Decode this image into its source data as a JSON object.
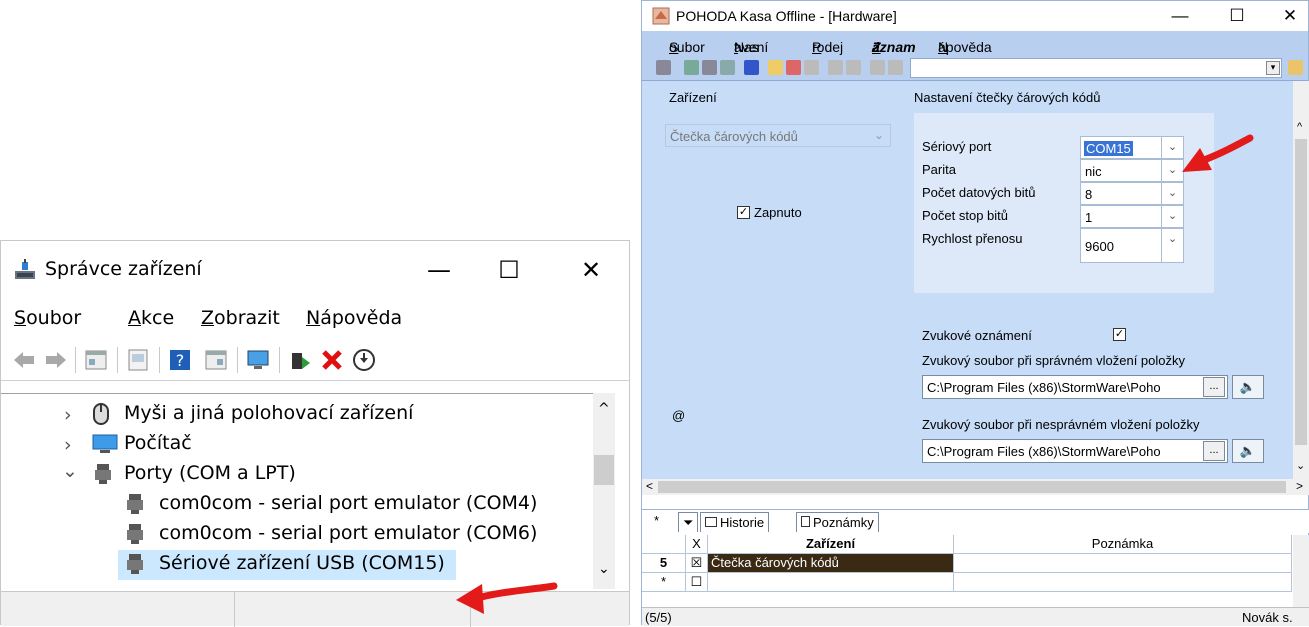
{
  "device_manager": {
    "title": "Správce zařízení",
    "menu": [
      "Soubor",
      "Akce",
      "Zobrazit",
      "Nápověda"
    ],
    "window_buttons": {
      "minimize": "—",
      "maximize": "☐",
      "close": "✕"
    },
    "tree": [
      {
        "label": "Myši a jiná polohovací zařízení",
        "expander": "›",
        "icon": "mouse-icon"
      },
      {
        "label": "Počítač",
        "expander": "›",
        "icon": "computer-icon"
      },
      {
        "label": "Porty (COM a LPT)",
        "expander": "⌄",
        "icon": "port-icon"
      },
      {
        "label": "com0com - serial port emulator (COM4)",
        "icon": "port-icon"
      },
      {
        "label": "com0com - serial port emulator (COM6)",
        "icon": "port-icon"
      },
      {
        "label": "Sériové zařízení USB (COM15)",
        "icon": "port-icon",
        "selected": true
      }
    ],
    "scroll_glyphs": {
      "up": "^",
      "down": "⌄"
    }
  },
  "pohoda": {
    "title": "POHODA Kasa Offline - [Hardware]",
    "window_buttons": {
      "minimize": "—",
      "maximize": "☐",
      "close": "✕"
    },
    "menu": [
      {
        "pre": "",
        "u": "S",
        "post": "oubor"
      },
      {
        "pre": "Nas",
        "u": "t",
        "post": "avení"
      },
      {
        "pre": "",
        "u": "P",
        "post": "rodej"
      },
      {
        "pre": "",
        "u": "Z",
        "post": "áznam"
      },
      {
        "pre": "",
        "u": "N",
        "post": "ápověda"
      }
    ],
    "left_panel": {
      "heading": "Zařízení",
      "device_select": "Čtečka čárových kódů",
      "enabled_label": "Zapnuto",
      "enabled_mark": "✓",
      "at_sign": "@"
    },
    "settings": {
      "heading": "Nastavení čtečky čárových kódů",
      "fields": [
        {
          "label": "Sériový port",
          "value": "COM15",
          "highlighted": true
        },
        {
          "label": "Parita",
          "value": "nic"
        },
        {
          "label": "Počet datových bitů",
          "value": "8"
        },
        {
          "label": "Počet stop bitů",
          "value": "1"
        },
        {
          "label": "Rychlost přenosu",
          "value": "9600"
        }
      ],
      "dropdown_glyph": "⌄",
      "sound_notification_label": "Zvukové oznámení",
      "sound_notification_mark": "✓",
      "sound_ok_label": "Zvukový soubor při správném vložení položky",
      "sound_ok_path": "C:\\Program Files (x86)\\StormWare\\Poho",
      "sound_err_label": "Zvukový soubor při nesprávném vložení položky",
      "sound_err_path": "C:\\Program Files (x86)\\StormWare\\Poho",
      "browse_label": "...",
      "speaker_glyph": "🔈"
    },
    "tabs": [
      "*",
      "Historie",
      "Poznámky"
    ],
    "grid": {
      "headers": [
        "X",
        "Zařízení",
        "Poznámka"
      ],
      "rows": [
        {
          "num": "5",
          "check": "☒",
          "device": "Čtečka čárových kódů",
          "note": ""
        },
        {
          "num": "*",
          "check": "☐",
          "device": "",
          "note": ""
        }
      ]
    },
    "status": {
      "left": "(5/5)",
      "right": "Novák s."
    },
    "scroll_glyphs": {
      "left": "<",
      "right": ">",
      "up": "^",
      "down": "⌄"
    }
  },
  "colors": {
    "arrow": "#e21a1a",
    "selection": "#cce8ff",
    "pohoda_panel": "#c7dcf7",
    "pohoda_bar": "#b8cff0"
  }
}
